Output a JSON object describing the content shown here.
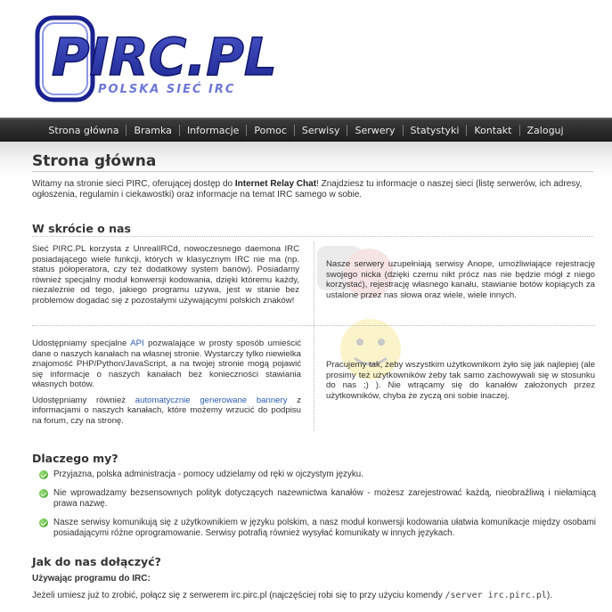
{
  "logo": {
    "main": "PIRC.PL",
    "tagline": "POLSKA SIEĆ IRC"
  },
  "nav": [
    "Strona główna",
    "Bramka",
    "Informacje",
    "Pomoc",
    "Serwisy",
    "Serwery",
    "Statystyki",
    "Kontakt",
    "Zaloguj"
  ],
  "page": {
    "title": "Strona główna",
    "intro_pre": "Witamy na stronie sieci PIRC, oferującej dostęp do ",
    "intro_bold": "Internet Relay Chat",
    "intro_post": "! Znajdziesz tu informacje o naszej sieci (listę serwerów, ich adresy, ogłoszenia, regulamin i ciekawostki) oraz informacje na temat IRC samego w sobie."
  },
  "overview": {
    "heading": "W skrócie o nas",
    "cell1": "Sieć PIRC.PL korzysta z UnrealIRCd, nowoczesnego daemona IRC posiadającego wiele funkcji, których w klasycznym IRC nie ma (np. status półoperatora, czy też dodatkowy system banów). Posiadamy również specjalny moduł konwersji kodowania, dzięki któremu każdy, niezależnie od tego, jakiego programu używa, jest w stanie bez problemów dogadać się z pozostałymi używającymi polskich znaków!",
    "cell2": "Nasze serwery uzupełniają serwisy Anope, umożliwiające rejestrację swojego nicka (dzięki czemu nikt prócz nas nie będzie mógł z niego korzystać), rejestrację własnego kanału, stawianie botów kopiących za ustalone przez nas słowa oraz wiele, wiele innych.",
    "cell3_a": "Udostępniamy specjalne ",
    "cell3_link": "API",
    "cell3_b": " pozwalające w prosty sposób umieścić dane o naszych kanałach na własnej stronie. Wystarczy tylko niewielka znajomość PHP/Python/JavaScript, a na twojej stronie mogą pojawić się informacje o naszych kanałach bez konieczności stawiania własnych botów.",
    "cell3_c": "Udostępniamy również ",
    "cell3_link2": "automatycznie generowane bannery",
    "cell3_d": " z informacjami o naszych kanałach, które możemy wrzucić do podpisu na forum, czy na stronę.",
    "cell4": "Pracujemy tak, żeby wszystkim użytkownikom żyło się jak najlepiej (ale prosimy też użytkowników żeby tak samo zachowywali się w stosunku do nas ;) ). Nie wtrącamy się do kanałów założonych przez użytkowników, chyba że zyczą oni sobie inaczej."
  },
  "why": {
    "heading": "Dlaczego my?",
    "items": [
      "Przyjazna, polska administracja - pomocy udzielamy od ręki w ojczystym języku.",
      "Nie wprowadzamy bezsensownych polityk dotyczących nazewnictwa kanałów - możesz zarejestrować każdą, nieobraźliwą i niełamiącą prawa nazwę.",
      "Nasze serwisy komunikują się z użytkownikiem w języku polskim, a nasz moduł konwersji kodowania ułatwia komunikacje między osobami posiadającymi różne oprogramowanie. Serwisy potrafią również wysyłać komunikaty w innych językach."
    ]
  },
  "join": {
    "heading": "Jak do nas dołączyć?",
    "subheading": "Używając programu do IRC:",
    "para_pre": "Jeżeli umiesz już to zrobić, połącz się z serwerem irc.pirc.pl (najczęściej robi się to przy użyciu komendy ",
    "command": "/server irc.pirc.pl",
    "para_post": ")."
  }
}
